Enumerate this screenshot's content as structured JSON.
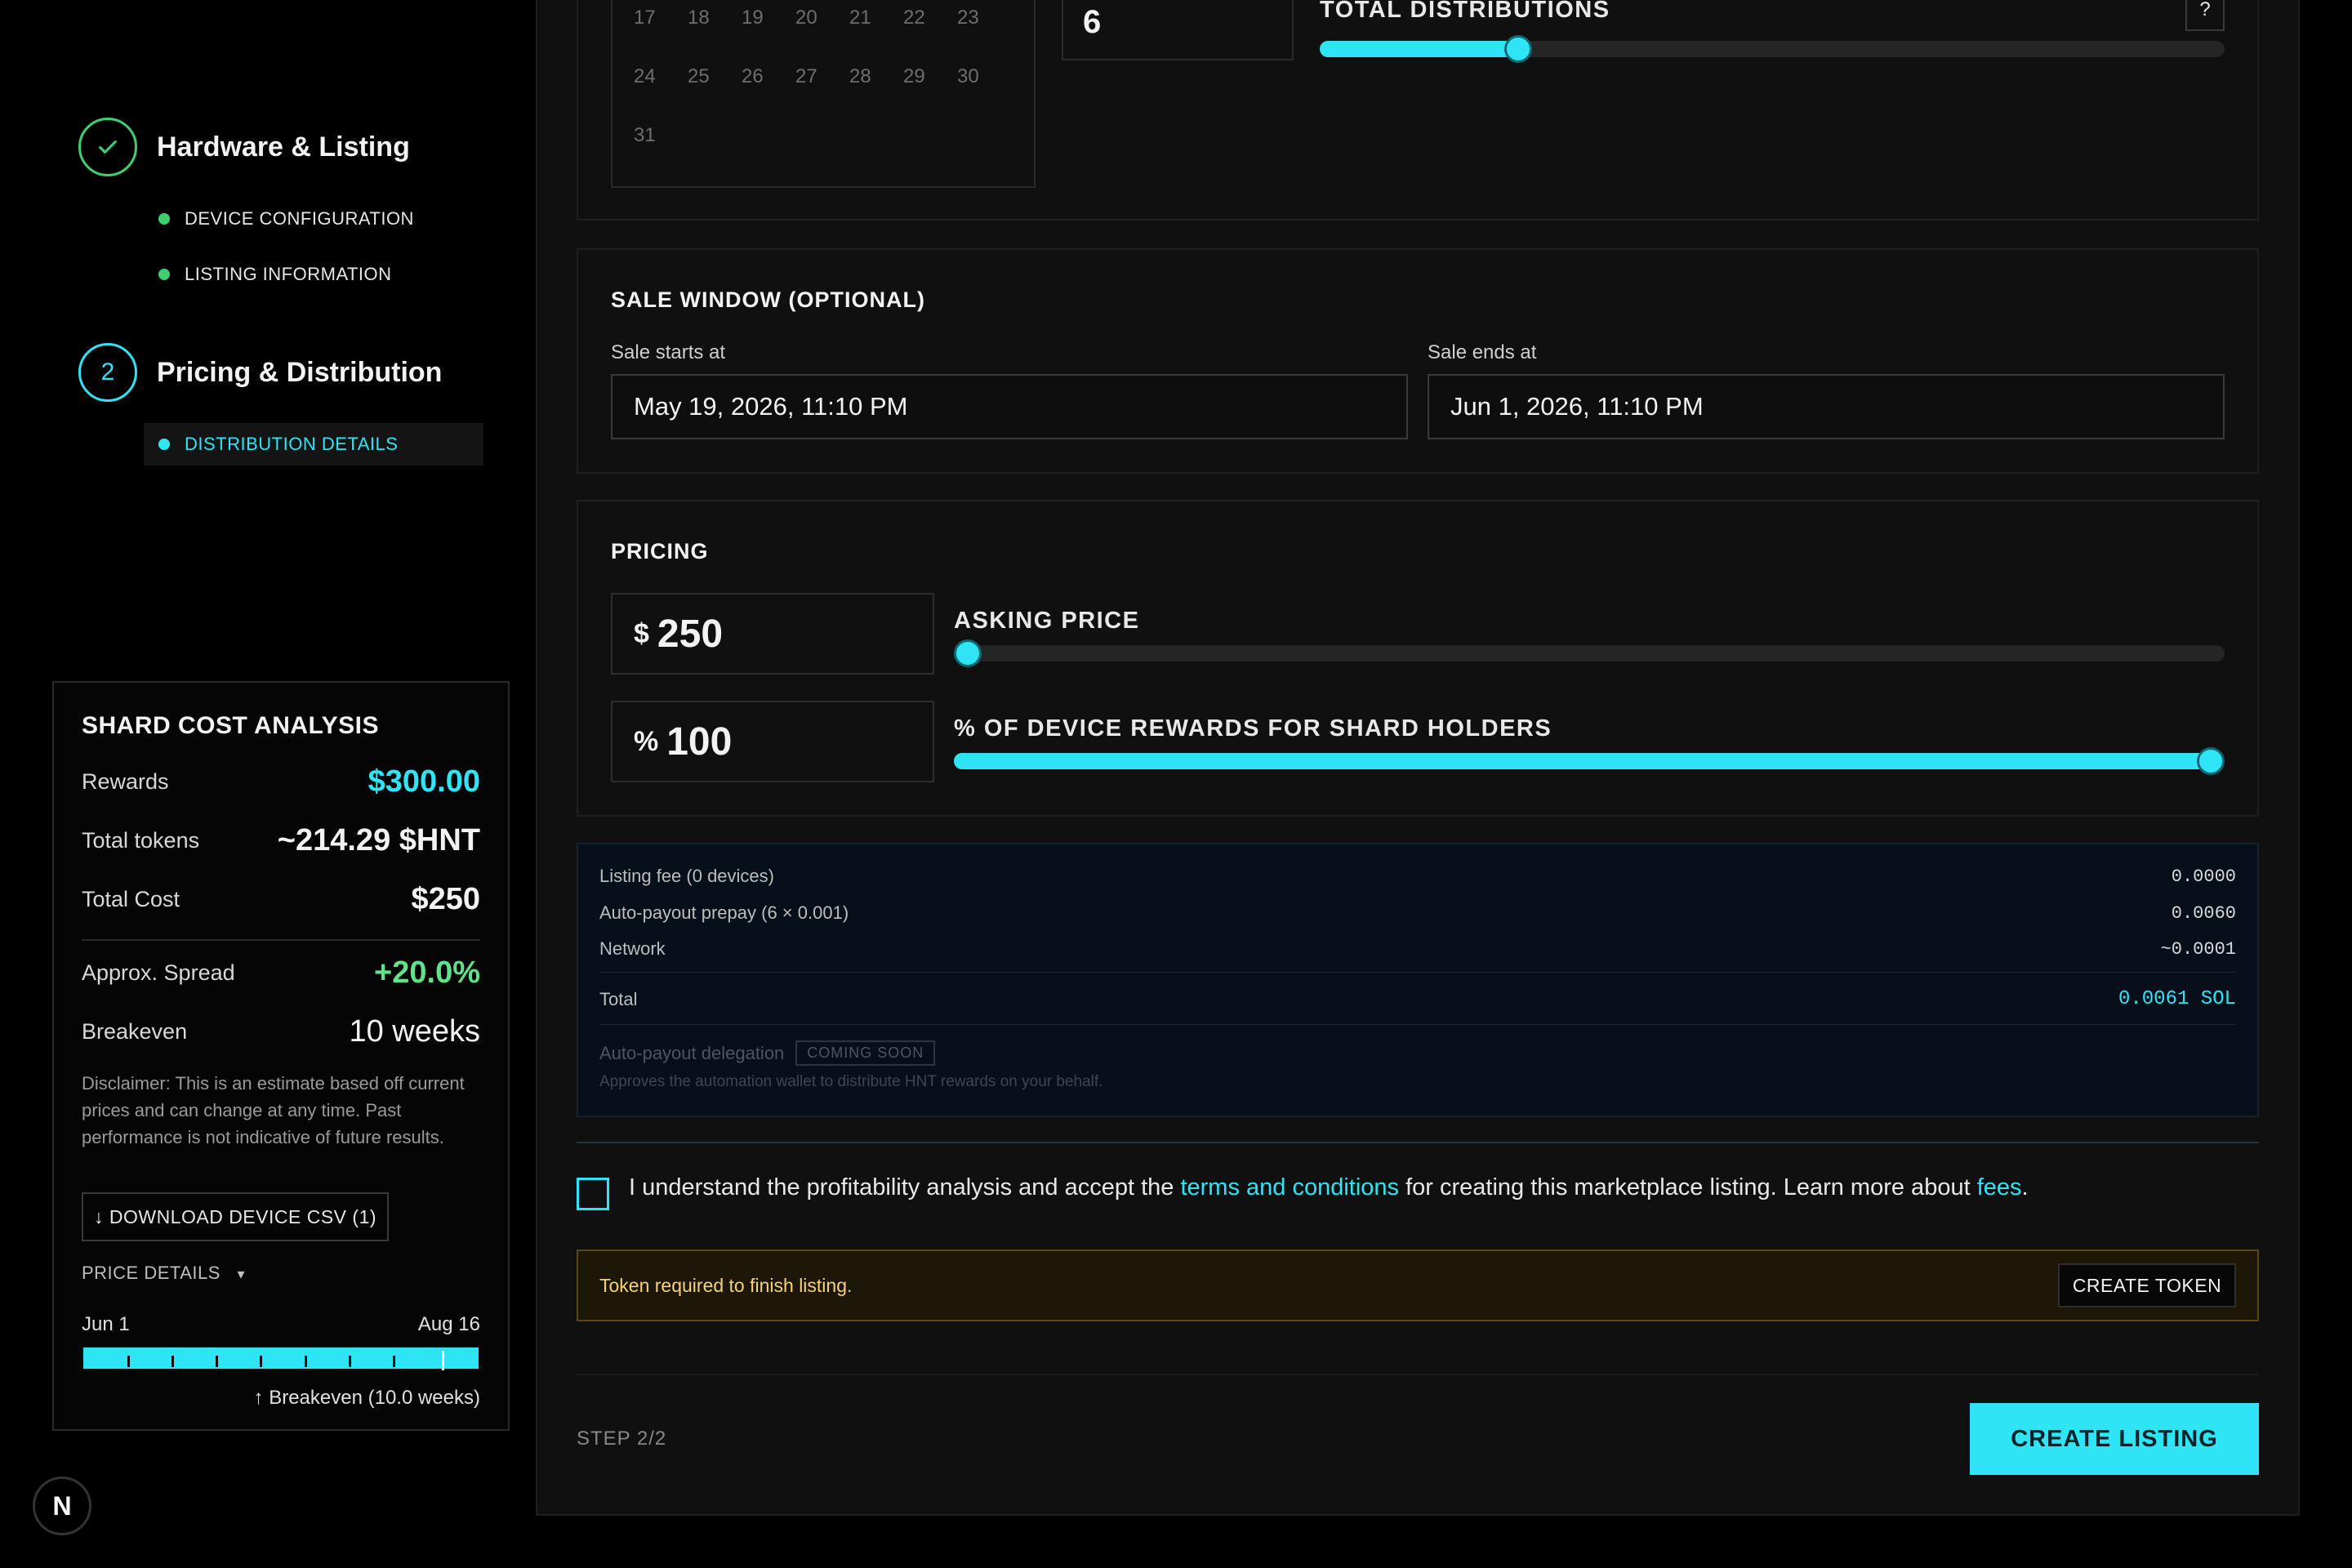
{
  "stepper": {
    "step1": {
      "title": "Hardware & Listing",
      "icon": "check-icon",
      "subs": [
        "DEVICE CONFIGURATION",
        "LISTING INFORMATION"
      ]
    },
    "step2": {
      "number": "2",
      "title": "Pricing & Distribution",
      "subs": [
        "DISTRIBUTION DETAILS"
      ]
    }
  },
  "shard": {
    "title": "SHARD COST ANALYSIS",
    "rows": [
      {
        "label": "Rewards",
        "value": "$300.00"
      },
      {
        "label": "Total tokens",
        "value": "~214.29 $HNT"
      },
      {
        "label": "Total Cost",
        "value": "$250"
      },
      {
        "label": "Approx. Spread",
        "value": "+20.0%"
      },
      {
        "label": "Breakeven",
        "value": "10 weeks"
      }
    ],
    "disclaimer": "Disclaimer: This is an estimate based off current prices and can change at any time. Past performance is not indicative of future results.",
    "download_label": "↓ DOWNLOAD DEVICE CSV (1)",
    "price_details_label": "PRICE DETAILS",
    "price_details_arrow": "▾",
    "timeline": {
      "start": "Jun 1",
      "end": "Aug 16",
      "breakeven_label": "↑ Breakeven (10.0 weeks)",
      "weeks_total": 11,
      "breakeven_weeks": 10.0
    }
  },
  "distribution": {
    "calendar_rows": [
      [
        "17",
        "18",
        "19",
        "20",
        "21",
        "22",
        "23"
      ],
      [
        "24",
        "25",
        "26",
        "27",
        "28",
        "29",
        "30"
      ],
      [
        "31"
      ]
    ],
    "total_value": "6",
    "label": "TOTAL DISTRIBUTIONS",
    "slider_fraction": 0.21,
    "help": "?"
  },
  "sale_window": {
    "title": "SALE WINDOW (OPTIONAL)",
    "start_label": "Sale starts at",
    "start_value": "May 19, 2026, 11:10 PM",
    "end_label": "Sale ends at",
    "end_value": "Jun 1, 2026, 11:10 PM"
  },
  "pricing": {
    "title": "PRICING",
    "asking": {
      "unit": "$",
      "value": "250",
      "label": "ASKING PRICE",
      "fraction": 0.0
    },
    "rewards": {
      "unit": "%",
      "value": "100",
      "label": "% OF DEVICE REWARDS FOR SHARD HOLDERS",
      "fraction": 1.0
    }
  },
  "fees": {
    "rows": [
      {
        "label": "Listing fee (0 devices)",
        "value": "0.0000"
      },
      {
        "label": "Auto-payout prepay (6 × 0.001)",
        "value": "0.0060"
      },
      {
        "label": "Network",
        "value": "~0.0001"
      }
    ],
    "total_label": "Total",
    "total_value": "0.0061 SOL",
    "delegation_label": "Auto-payout delegation",
    "delegation_badge": "COMING SOON",
    "delegation_desc": "Approves the automation wallet to distribute HNT rewards on your behalf."
  },
  "terms": {
    "before": "I understand the profitability analysis and accept the ",
    "link1": "terms and conditions",
    "middle": " for creating this marketplace listing. Learn more about ",
    "link2": "fees",
    "after": "."
  },
  "warning": {
    "text": "Token required to finish listing.",
    "button": "CREATE TOKEN"
  },
  "footer": {
    "step": "STEP 2/2",
    "create_label": "CREATE LISTING"
  },
  "badge": "N",
  "colors": {
    "accent": "#2fe4f5",
    "success": "#3ecf6e",
    "warning_text": "#f4d27a"
  }
}
